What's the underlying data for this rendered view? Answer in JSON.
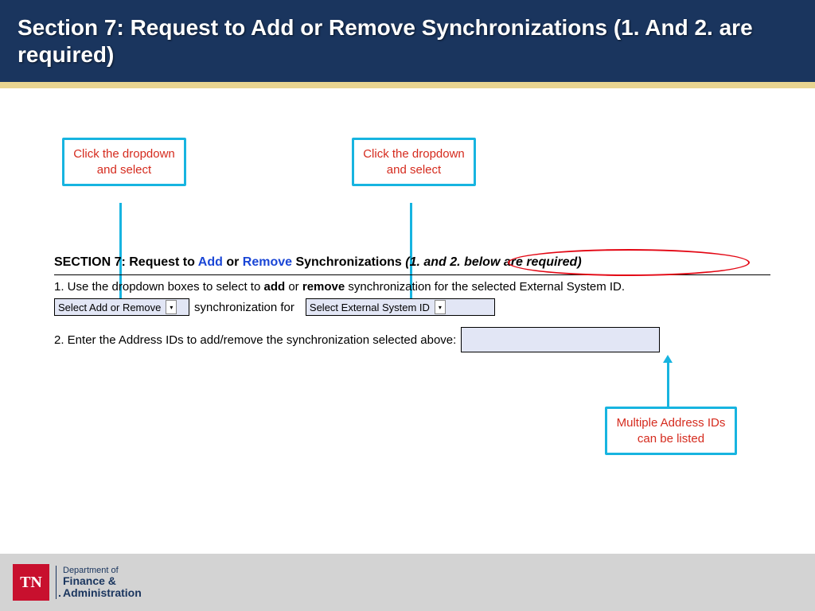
{
  "header": {
    "title": "Section 7: Request to Add or Remove Synchronizations (1. And 2. are required)"
  },
  "callouts": {
    "c1": "Click the dropdown and select",
    "c2": "Click the dropdown and select",
    "c3": "Multiple Address IDs can be listed"
  },
  "form": {
    "section_label": "SECTION 7: Request to ",
    "add": "Add",
    "or": " or ",
    "remove": "Remove",
    "sync_word": " Synchronizations ",
    "required": "(1. and 2. below are required)",
    "line1_pre": "1. Use the dropdown boxes to select to ",
    "line1_add": "add",
    "line1_or": " or ",
    "line1_remove": "remove",
    "line1_post": " synchronization for the selected External System ID.",
    "select1": "Select Add or Remove",
    "mid_text": "synchronization for",
    "select2": "Select External System ID",
    "line2": "2. Enter the Address IDs to add/remove the synchronization selected above:"
  },
  "footer": {
    "badge": "TN",
    "dept1": "Department of",
    "dept2": "Finance &",
    "dept3": "Administration"
  }
}
